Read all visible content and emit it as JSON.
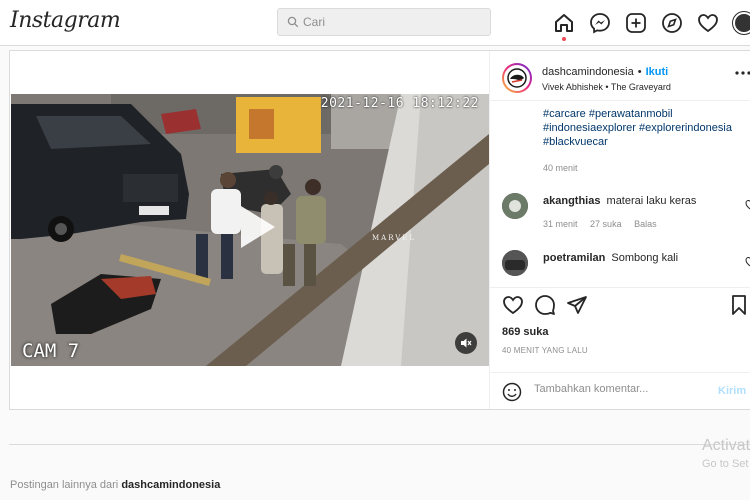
{
  "header": {
    "logo": "Instagram",
    "search_placeholder": "Cari"
  },
  "post": {
    "video": {
      "timestamp": "2021-12-16 18:12:22",
      "camera_label": "CAM 7",
      "brand_watermark": "MARVEL"
    },
    "author": {
      "username": "dashcamindonesia",
      "follow_label": "Ikuti",
      "audio": "Vivek Abhishek",
      "audio_title": "The Graveyard"
    },
    "caption": {
      "hashtags": "#carcare #perawatanmobil #indonesiaexplorer #explorerindonesia #blackvuecar",
      "time": "40 menit"
    },
    "comments": [
      {
        "username": "akangthias",
        "text": "materai laku keras",
        "time": "31 menit",
        "likes": "27 suka",
        "reply": "Balas"
      },
      {
        "username": "poetramilan",
        "text": "Sombong kali",
        "time": "",
        "likes": "",
        "reply": ""
      }
    ],
    "likes": "869 suka",
    "posted_ago": "40 MENIT YANG LALU",
    "add_comment_placeholder": "Tambahkan komentar...",
    "post_button": "Kirim"
  },
  "more_posts": {
    "prefix": "Postingan lainnya dari",
    "username": "dashcamindonesia"
  },
  "os_overlay": {
    "line1": "Activat",
    "line2": "Go to Set"
  },
  "colors": {
    "accent": "#0095f6",
    "notification": "#ed4956",
    "border": "#dbdbdb"
  }
}
